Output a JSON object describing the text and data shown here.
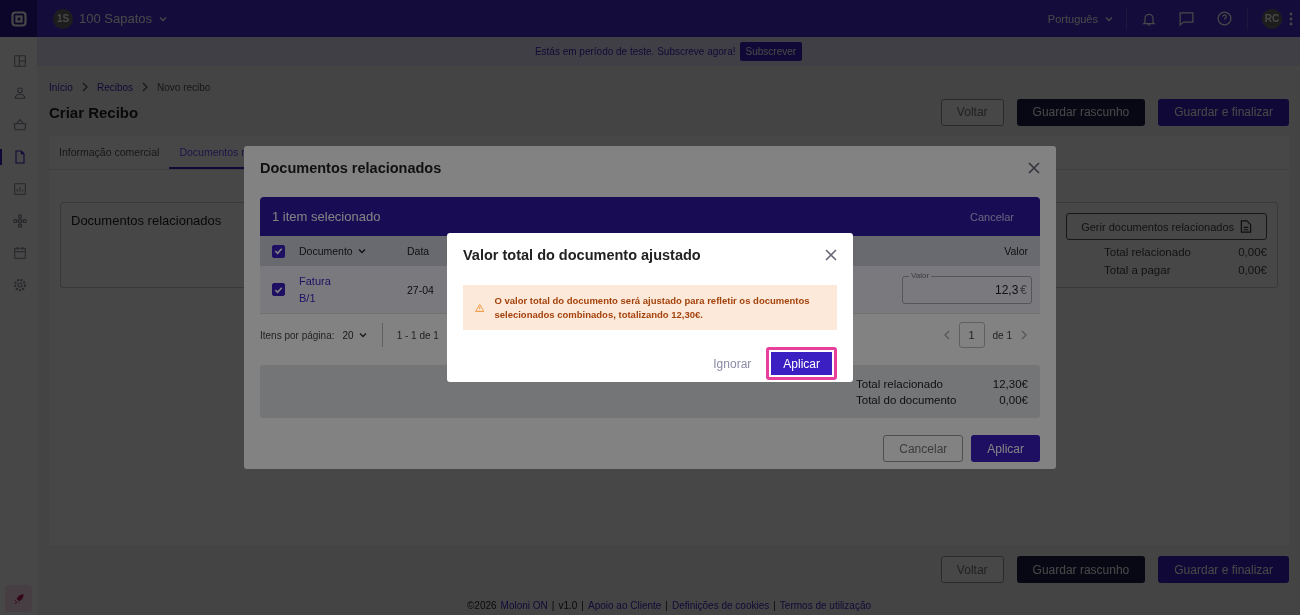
{
  "topbar": {
    "company_avatar": "1S",
    "company": "100 Sapatos",
    "language": "Português",
    "user_avatar": "RC"
  },
  "trial_banner": {
    "text": "Estás em período de teste. Subscreve agora!",
    "button": "Subscrever"
  },
  "sidebar": {
    "items": [
      {
        "kind": "layout",
        "selected": false
      },
      {
        "kind": "user",
        "selected": false
      },
      {
        "kind": "basket",
        "selected": false
      },
      {
        "kind": "document",
        "selected": true
      },
      {
        "kind": "chart",
        "selected": false
      },
      {
        "kind": "hierarchy",
        "selected": false
      },
      {
        "kind": "calendar",
        "selected": false
      },
      {
        "kind": "gear",
        "selected": false
      }
    ]
  },
  "breadcrumb": [
    "Início",
    "Recibos",
    "Novo recibo"
  ],
  "page_title": "Criar Recibo",
  "header_buttons": [
    {
      "label": "Voltar",
      "kind": "outline"
    },
    {
      "label": "Guardar rascunho",
      "kind": "dark"
    },
    {
      "label": "Guardar e finalizar",
      "kind": "primary"
    }
  ],
  "tabs": [
    {
      "label": "Informação comercial",
      "selected": false
    },
    {
      "label": "Documentos r",
      "selected": true
    }
  ],
  "related_card": {
    "title": "Documentos relacionados",
    "manage_button": "Gerir documentos relacionados",
    "totals": [
      {
        "label": "Total relacionado",
        "value": "0,00€"
      },
      {
        "label": "Total a pagar",
        "value": "0,00€"
      }
    ]
  },
  "footer_buttons": [
    {
      "label": "Voltar",
      "kind": "outline"
    },
    {
      "label": "Guardar rascunho",
      "kind": "dark"
    },
    {
      "label": "Guardar e finalizar",
      "kind": "primary"
    }
  ],
  "footer": [
    {
      "text": "©2026",
      "kind": "text"
    },
    {
      "text": "Moloni ON",
      "kind": "link"
    },
    {
      "text": "|",
      "kind": "sep"
    },
    {
      "text": "v1.0",
      "kind": "text"
    },
    {
      "text": "|",
      "kind": "sep"
    },
    {
      "text": "Apoio ao Cliente",
      "kind": "link"
    },
    {
      "text": "|",
      "kind": "sep"
    },
    {
      "text": "Definições de cookies",
      "kind": "link"
    },
    {
      "text": "|",
      "kind": "sep"
    },
    {
      "text": "Termos de utilização",
      "kind": "link"
    }
  ],
  "related_modal": {
    "title": "Documentos relacionados",
    "selection_bar": {
      "text": "1 item selecionado",
      "cancel": "Cancelar"
    },
    "select_all_checked": true,
    "columns": [
      {
        "label": "Documento",
        "sortable": true
      },
      {
        "label": "Data",
        "sortable": false
      },
      {
        "label": "Valor",
        "sortable": false
      }
    ],
    "rows": [
      {
        "checked": true,
        "document": "Fatura B/1",
        "date": "27-04",
        "value_label": "Valor",
        "value": "12,3",
        "currency": "€"
      }
    ],
    "pagination": {
      "per_page_label": "Itens por página:",
      "per_page": "20",
      "range": "1 - 1 de 1",
      "page": "1",
      "of": "de 1"
    },
    "summary": [
      {
        "label": "Total relacionado",
        "value": "12,30€"
      },
      {
        "label": "Total do documento",
        "value": "0,00€"
      }
    ],
    "buttons": [
      {
        "label": "Cancelar",
        "kind": "outline"
      },
      {
        "label": "Aplicar",
        "kind": "primary"
      }
    ]
  },
  "confirm_modal": {
    "title": "Valor total do documento ajustado",
    "alert": "O valor total do documento será ajustado para refletir os documentos selecionados combinados, totalizando 12,30€.",
    "buttons": [
      {
        "label": "Ignorar",
        "kind": "text",
        "focused": false
      },
      {
        "label": "Aplicar",
        "kind": "primary",
        "focused": true
      }
    ]
  }
}
